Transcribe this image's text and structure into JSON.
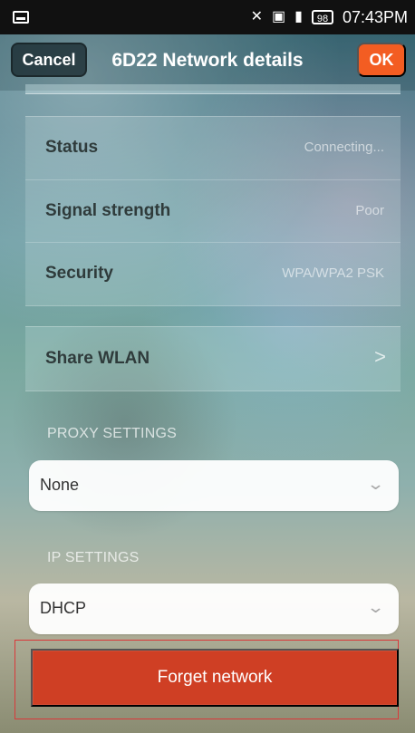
{
  "status_bar": {
    "left_icon": "screen-icon",
    "wifi_icon": "wifi-off-icon",
    "data_icon": "mobile-data-icon",
    "signal_icon": "signal-icon",
    "battery": "98",
    "time": "07:43PM"
  },
  "header": {
    "cancel_label": "Cancel",
    "title": "6D22 Network details",
    "ok_label": "OK"
  },
  "details": [
    {
      "label": "Status",
      "value": "Connecting..."
    },
    {
      "label": "Signal strength",
      "value": "Poor"
    },
    {
      "label": "Security",
      "value": "WPA/WPA2 PSK"
    }
  ],
  "share": {
    "label": "Share WLAN",
    "arrow": ">"
  },
  "proxy": {
    "section_label": "PROXY SETTINGS",
    "value": "None",
    "chevron": "⌄"
  },
  "ip": {
    "section_label": "IP SETTINGS",
    "value": "DHCP",
    "chevron": "⌄"
  },
  "forget": {
    "label": "Forget network"
  },
  "colors": {
    "accent": "#f35d22",
    "forget_button": "#cf3f24",
    "highlight_outline": "#d9393a"
  }
}
